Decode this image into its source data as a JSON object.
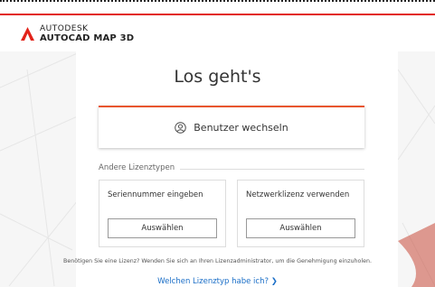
{
  "brand": {
    "company": "AUTODESK",
    "product": "AUTOCAD MAP 3D",
    "logo_color": "#e2231a"
  },
  "main": {
    "title": "Los geht's",
    "switch_user": {
      "label": "Benutzer wechseln",
      "icon": "user-circle-icon",
      "accent": "#e8552e"
    },
    "other_license_types_label": "Andere Lizenztypen",
    "options": [
      {
        "title": "Seriennummer eingeben",
        "button": "Auswählen"
      },
      {
        "title": "Netzwerklizenz verwenden",
        "button": "Auswählen"
      }
    ],
    "help_text": "Benötigen Sie eine Lizenz? Wenden Sie sich an Ihren Lizenzadministrator, um die Genehmigung einzuholen.",
    "footer_link": {
      "label": "Welchen Lizenztyp habe ich?",
      "icon": "chevron-right-icon",
      "color": "#1a6ec7"
    }
  }
}
